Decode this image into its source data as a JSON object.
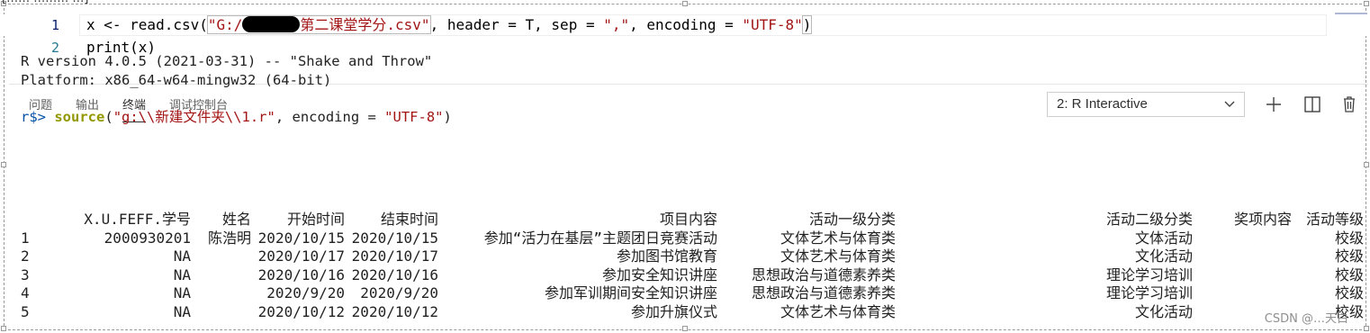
{
  "cropped_title": "[……·………·…]",
  "editor": {
    "lines": [
      {
        "number": "1"
      },
      {
        "number": "2",
        "text": "print(x)"
      }
    ],
    "line1": {
      "prefix": "x <- read.csv(",
      "str_part1": "\"G:/",
      "str_part2": "第二课堂学分.csv\"",
      "mid": ", header = T, sep = ",
      "sep_value": "\",\"",
      "mid2": ", encoding = ",
      "enc_value": "\"UTF-8\"",
      "suffix": ")"
    }
  },
  "panel": {
    "tabs": [
      {
        "label": "问题"
      },
      {
        "label": "输出"
      },
      {
        "label": "终端",
        "active": true
      },
      {
        "label": "调试控制台"
      }
    ],
    "terminal_select": "2: R Interactive",
    "icons": [
      "plus-icon",
      "split-icon",
      "trash-icon"
    ]
  },
  "terminal": {
    "version_line": "R version 4.0.5 (2021-03-31) -- \"Shake and Throw\"",
    "platform_line": "Platform: x86_64-w64-mingw32 (64-bit)",
    "prompt": "r$>",
    "cmd_fn": "source",
    "cmd_path": "\"g:\\\\新建文件夹\\\\1.r\"",
    "cmd_rest": ", encoding = ",
    "cmd_enc": "\"UTF-8\"",
    "cmd_end": ")"
  },
  "table": {
    "headers": [
      "",
      "X.U.FEFF.学号",
      "姓名",
      "开始时间",
      "结束时间",
      "项目内容",
      "活动一级分类",
      "活动二级分类",
      "奖项内容",
      "活动等级"
    ],
    "rows": [
      [
        "1",
        "2000930201",
        "陈浩明",
        "2020/10/15",
        "2020/10/15",
        "参加“活力在基层”主题团日竞赛活动",
        "文体艺术与体育类",
        "文体活动",
        "",
        "校级"
      ],
      [
        "2",
        "NA",
        "",
        "2020/10/17",
        "2020/10/17",
        "参加图书馆教育",
        "文体艺术与体育类",
        "文化活动",
        "",
        "校级"
      ],
      [
        "3",
        "NA",
        "",
        "2020/10/16",
        "2020/10/16",
        "参加安全知识讲座",
        "思想政治与道德素养类",
        "理论学习培训",
        "",
        "校级"
      ],
      [
        "4",
        "NA",
        "",
        "2020/9/20",
        "2020/9/20",
        "参加军训期间安全知识讲座",
        "思想政治与道德素养类",
        "理论学习培训",
        "",
        "校级"
      ],
      [
        "5",
        "NA",
        "",
        "2020/10/12",
        "2020/10/12",
        "参加升旗仪式",
        "文体艺术与体育类",
        "文化活动",
        "",
        "校级"
      ]
    ]
  },
  "watermark": "CSDN @…天白"
}
